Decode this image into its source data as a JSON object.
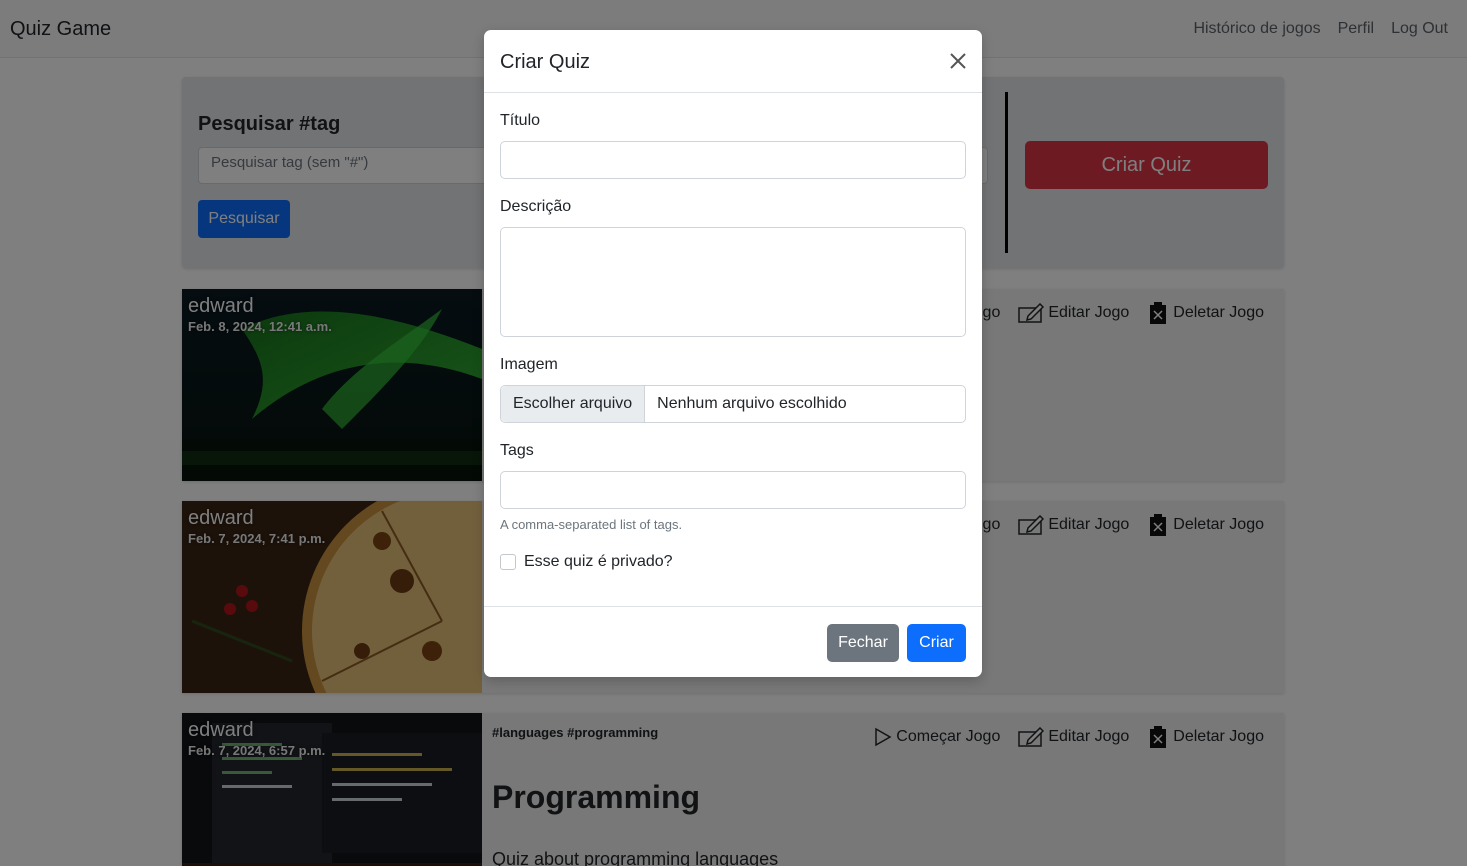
{
  "navbar": {
    "brand": "Quiz Game",
    "links": [
      "Histórico de jogos",
      "Perfil",
      "Log Out"
    ]
  },
  "search": {
    "title": "Pesquisar #tag",
    "placeholder": "Pesquisar tag (sem \"#\")",
    "button": "Pesquisar"
  },
  "create_quiz_button": "Criar Quiz",
  "actions": {
    "start": "Começar Jogo",
    "edit": "Editar Jogo",
    "delete": "Deletar Jogo"
  },
  "cards": [
    {
      "author": "edward",
      "date": "Feb. 8, 2024, 12:41 a.m.",
      "image": "aurora-photo"
    },
    {
      "author": "edward",
      "date": "Feb. 7, 2024, 7:41 p.m.",
      "image": "pizza-photo"
    },
    {
      "author": "edward",
      "date": "Feb. 7, 2024, 6:57 p.m.",
      "image": "code-screen-photo",
      "tags": "#languages #programming",
      "title": "Programming",
      "description": "Quiz about programming languages"
    }
  ],
  "modal": {
    "title": "Criar Quiz",
    "fields": {
      "title_label": "Título",
      "description_label": "Descrição",
      "image_label": "Imagem",
      "file_button": "Escolher arquivo",
      "file_status": "Nenhum arquivo escolhido",
      "tags_label": "Tags",
      "tags_help": "A comma-separated list of tags.",
      "private_label": "Esse quiz é privado?"
    },
    "close_button": "Fechar",
    "submit_button": "Criar"
  },
  "colors": {
    "primary": "#0d6efd",
    "danger": "#dc3545",
    "secondary": "#6c757d"
  }
}
